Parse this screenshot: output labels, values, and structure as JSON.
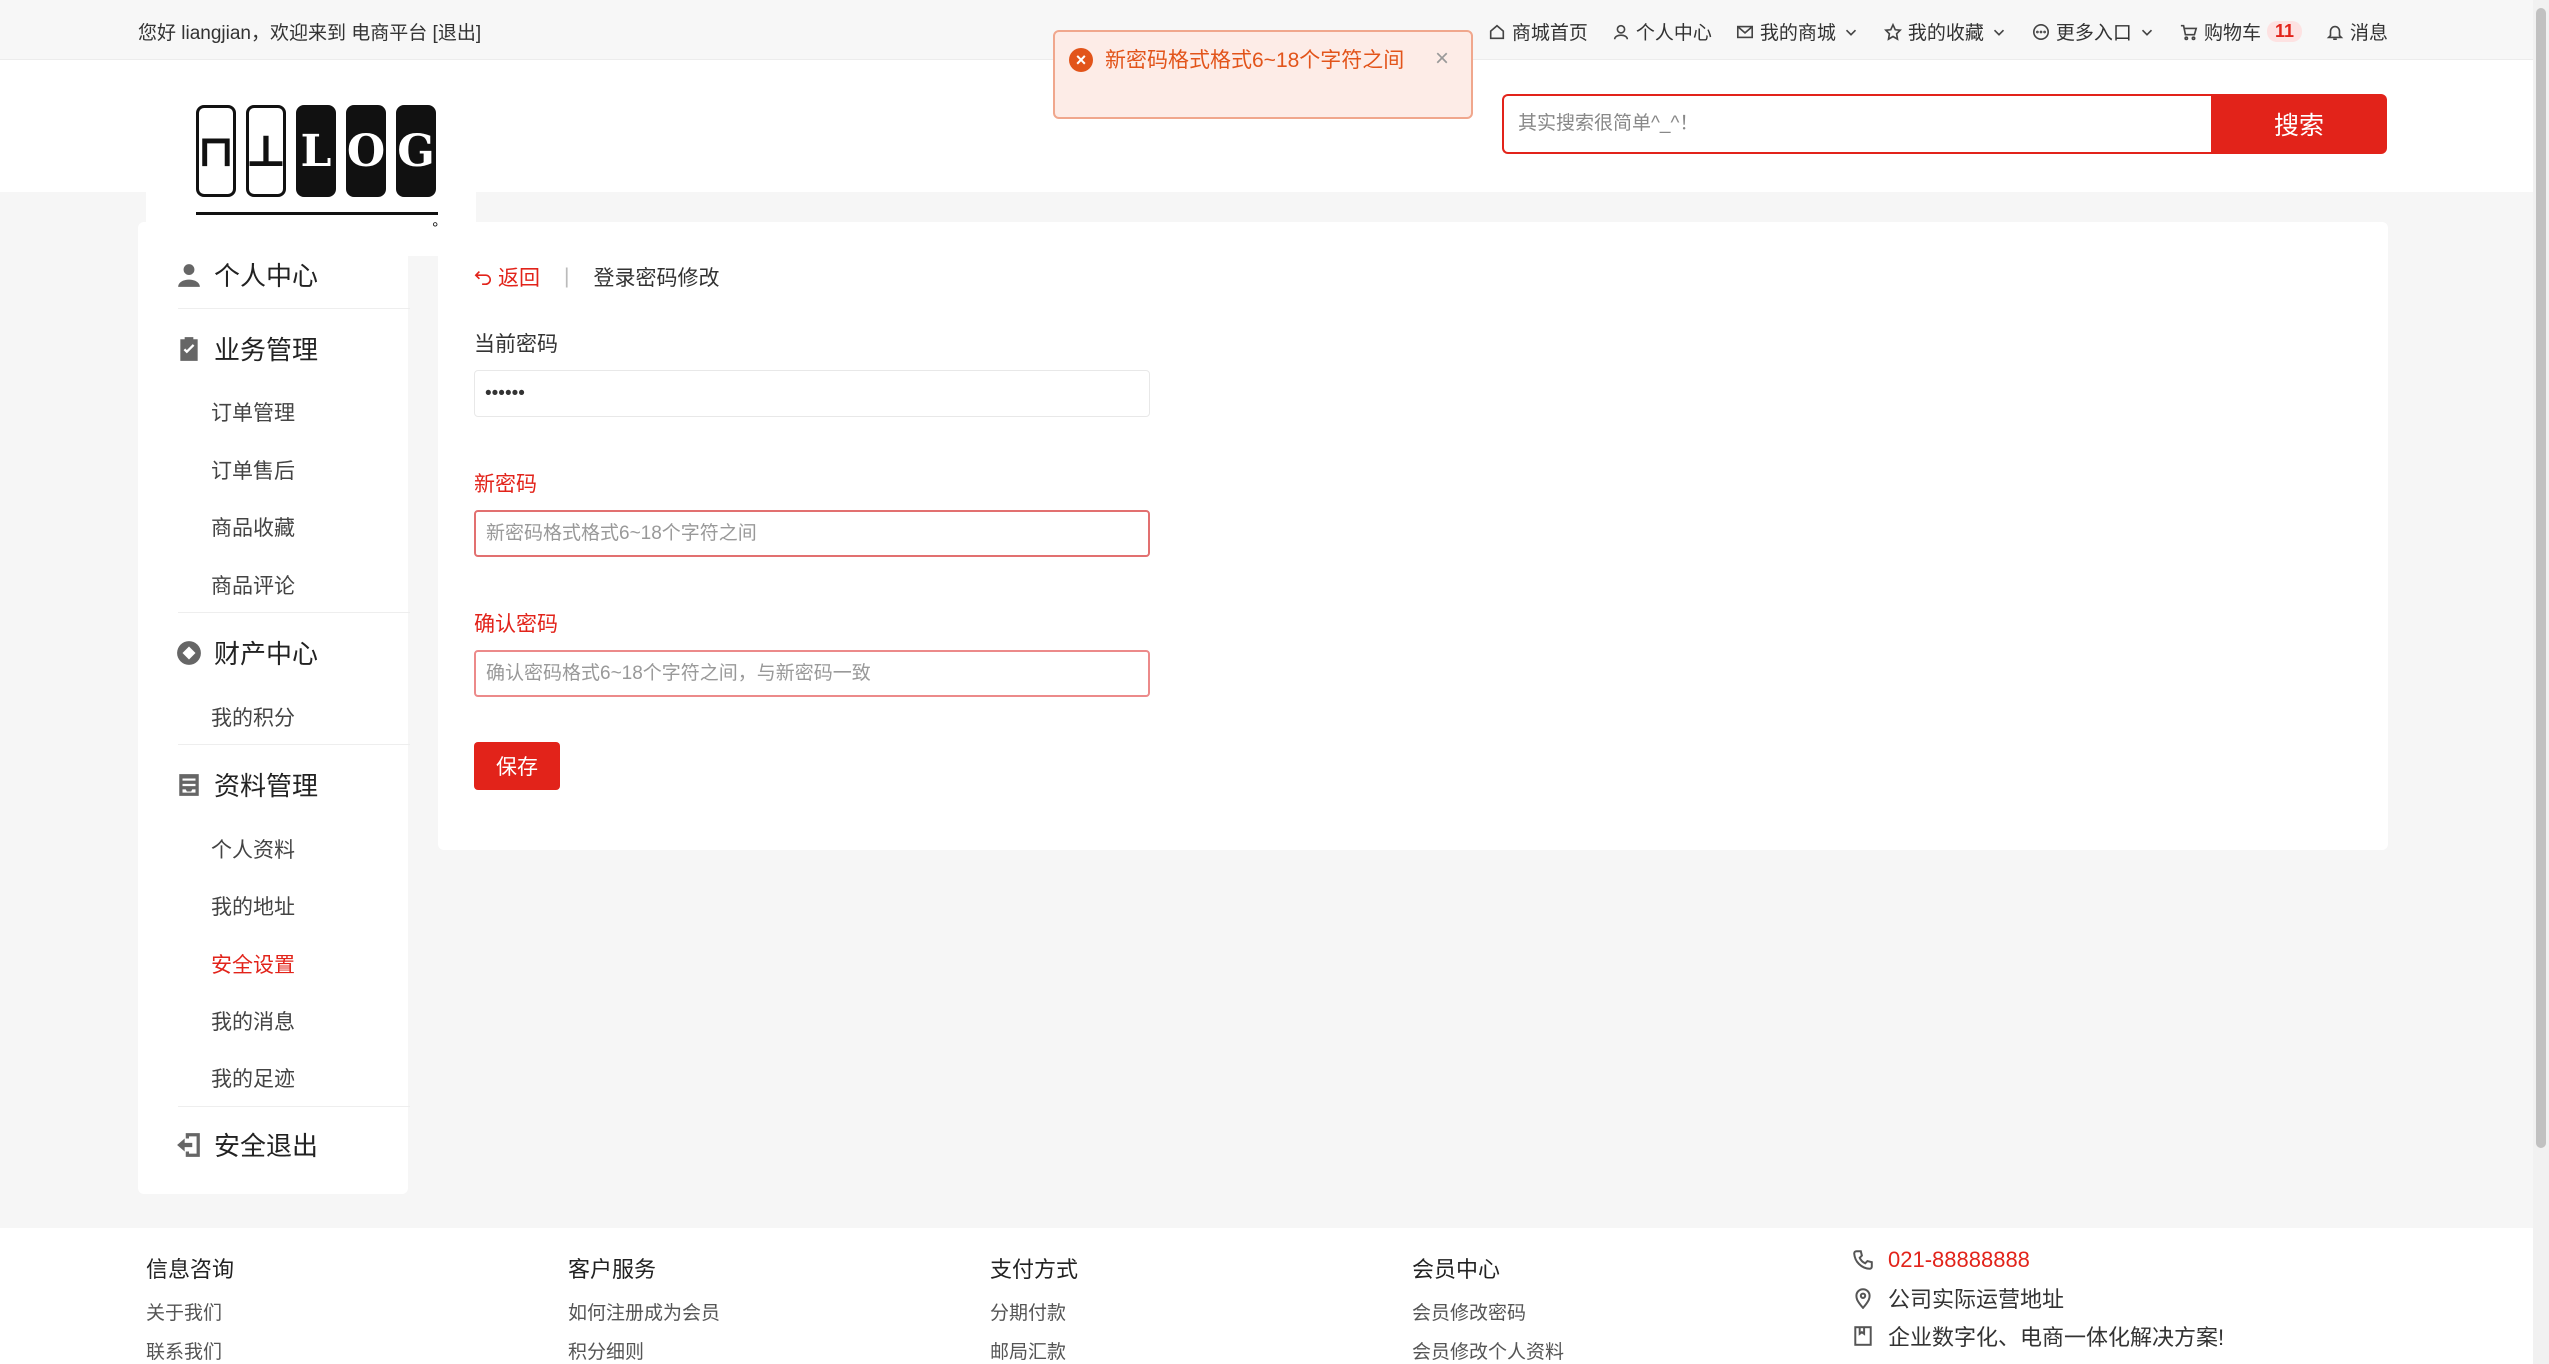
{
  "topbar": {
    "greeting": "您好 liangjian，欢迎来到 电商平台 [退出]",
    "nav": {
      "home": "商城首页",
      "user_center": "个人中心",
      "my_mall": "我的商城",
      "favorites": "我的收藏",
      "more": "更多入口",
      "cart": "购物车",
      "cart_count": "11",
      "messages": "消息"
    }
  },
  "toast": {
    "message": "新密码格式格式6~18个字符之间",
    "close": "×"
  },
  "search": {
    "placeholder": "其实搜索很简单^_^！",
    "button": "搜索"
  },
  "sidebar": {
    "personal_center": "个人中心",
    "business": "业务管理",
    "business_items": [
      "订单管理",
      "订单售后",
      "商品收藏",
      "商品评论"
    ],
    "assets": "财产中心",
    "assets_items": [
      "我的积分"
    ],
    "profile": "资料管理",
    "profile_items": [
      "个人资料",
      "我的地址",
      "安全设置",
      "我的消息",
      "我的足迹"
    ],
    "active_item": "安全设置",
    "logout": "安全退出"
  },
  "form": {
    "back": "返回",
    "title": "登录密码修改",
    "current_label": "当前密码",
    "current_value": "••••••",
    "new_label": "新密码",
    "new_placeholder": "新密码格式格式6~18个字符之间",
    "confirm_label": "确认密码",
    "confirm_placeholder": "确认密码格式6~18个字符之间，与新密码一致",
    "save": "保存"
  },
  "footer": {
    "info": {
      "title": "信息咨询",
      "links": [
        "关于我们",
        "联系我们"
      ]
    },
    "service": {
      "title": "客户服务",
      "links": [
        "如何注册成为会员",
        "积分细则"
      ]
    },
    "payment": {
      "title": "支付方式",
      "links": [
        "分期付款",
        "邮局汇款"
      ]
    },
    "member": {
      "title": "会员中心",
      "links": [
        "会员修改密码",
        "会员修改个人资料"
      ]
    },
    "phone": "021-88888888",
    "address": "公司实际运营地址",
    "slogan": "企业数字化、电商一体化解决方案!"
  },
  "colors": {
    "accent": "#e2231a",
    "toast_bg": "#fdece7"
  }
}
